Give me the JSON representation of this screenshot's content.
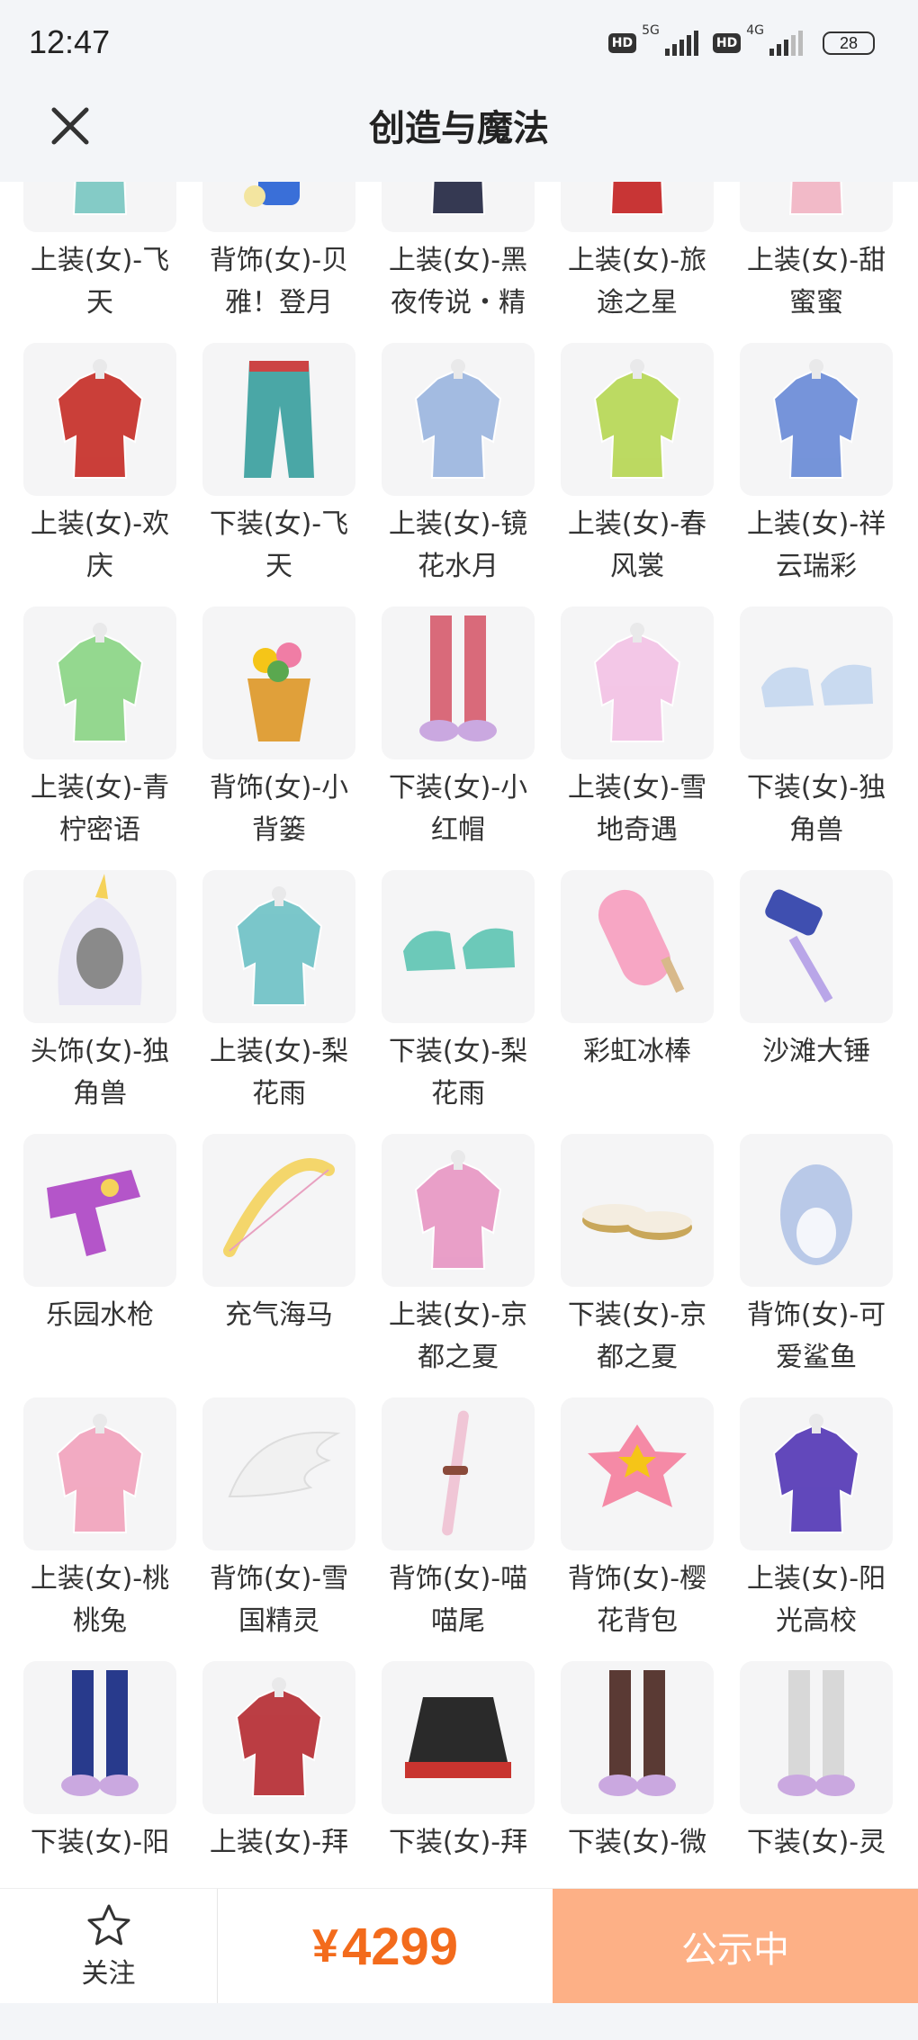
{
  "status_bar": {
    "time": "12:47",
    "hd_badge_1": "HD",
    "net_1": "5G",
    "hd_badge_2": "HD",
    "net_2": "4G",
    "battery": "28"
  },
  "header": {
    "close_icon": "close-icon",
    "title": "创造与魔法"
  },
  "items": [
    {
      "name": "上装(女)-飞天",
      "color": "#7fc9c4",
      "icon": "outfit"
    },
    {
      "name": "背饰(女)-贝雅！登月",
      "color": "#d9dde3",
      "icon": "astronaut"
    },
    {
      "name": "上装(女)-黑夜传说・精",
      "color": "#2b2f4a",
      "icon": "outfit"
    },
    {
      "name": "上装(女)-旅途之星",
      "color": "#c62b2b",
      "icon": "outfit"
    },
    {
      "name": "上装(女)-甜蜜蜜",
      "color": "#f2b7c6",
      "icon": "outfit"
    },
    {
      "name": "上装(女)-欢庆",
      "color": "#c8352f",
      "icon": "outfit"
    },
    {
      "name": "下装(女)-飞天",
      "color": "#4aa7a6",
      "icon": "pants"
    },
    {
      "name": "上装(女)-镜花水月",
      "color": "#9fb8e0",
      "icon": "outfit"
    },
    {
      "name": "上装(女)-春风裳",
      "color": "#b9d85a",
      "icon": "outfit"
    },
    {
      "name": "上装(女)-祥云瑞彩",
      "color": "#6f8fd8",
      "icon": "outfit"
    },
    {
      "name": "上装(女)-青柠密语",
      "color": "#8fd68a",
      "icon": "outfit"
    },
    {
      "name": "背饰(女)-小背篓",
      "color": "#e0a03a",
      "icon": "basket"
    },
    {
      "name": "下装(女)-小红帽",
      "color": "#d96a7a",
      "icon": "boots"
    },
    {
      "name": "上装(女)-雪地奇遇",
      "color": "#f3c4e6",
      "icon": "outfit"
    },
    {
      "name": "下装(女)-独角兽",
      "color": "#c9daf0",
      "icon": "shoes"
    },
    {
      "name": "头饰(女)-独角兽",
      "color": "#e8e6f4",
      "icon": "hood"
    },
    {
      "name": "上装(女)-梨花雨",
      "color": "#74c4c8",
      "icon": "outfit"
    },
    {
      "name": "下装(女)-梨花雨",
      "color": "#6cc9b9",
      "icon": "shoes"
    },
    {
      "name": "彩虹冰棒",
      "color": "#f7a6c4",
      "icon": "popsicle"
    },
    {
      "name": "沙滩大锤",
      "color": "#3f4fb0",
      "icon": "hammer"
    },
    {
      "name": "乐园水枪",
      "color": "#b455c9",
      "icon": "watergun"
    },
    {
      "name": "充气海马",
      "color": "#f4d66b",
      "icon": "bow"
    },
    {
      "name": "上装(女)-京都之夏",
      "color": "#e89ac6",
      "icon": "outfit"
    },
    {
      "name": "下装(女)-京都之夏",
      "color": "#c9a75a",
      "icon": "sandals"
    },
    {
      "name": "背饰(女)-可爱鲨鱼",
      "color": "#b9c9e8",
      "icon": "shark"
    },
    {
      "name": "上装(女)-桃桃兔",
      "color": "#f2a6bf",
      "icon": "outfit"
    },
    {
      "name": "背饰(女)-雪国精灵",
      "color": "#eeeeee",
      "icon": "wing"
    },
    {
      "name": "背饰(女)-喵喵尾",
      "color": "#f0c6d6",
      "icon": "tail"
    },
    {
      "name": "背饰(女)-樱花背包",
      "color": "#f58aa6",
      "icon": "bag"
    },
    {
      "name": "上装(女)-阳光高校",
      "color": "#5a3fb8",
      "icon": "outfit"
    },
    {
      "name": "下装(女)-阳",
      "color": "#283a8c",
      "icon": "boots"
    },
    {
      "name": "上装(女)-拜",
      "color": "#b8343a",
      "icon": "outfit"
    },
    {
      "name": "下装(女)-拜",
      "color": "#2a2a2a",
      "icon": "skirt"
    },
    {
      "name": "下装(女)-微",
      "color": "#5a3a34",
      "icon": "boots"
    },
    {
      "name": "下装(女)-灵",
      "color": "#d8d8d8",
      "icon": "boots"
    }
  ],
  "bottom_bar": {
    "follow_icon": "star-icon",
    "follow_label": "关注",
    "currency": "¥",
    "price": "4299",
    "cta_label": "公示中",
    "price_color": "#f36b1c",
    "cta_color": "#fdb086"
  }
}
